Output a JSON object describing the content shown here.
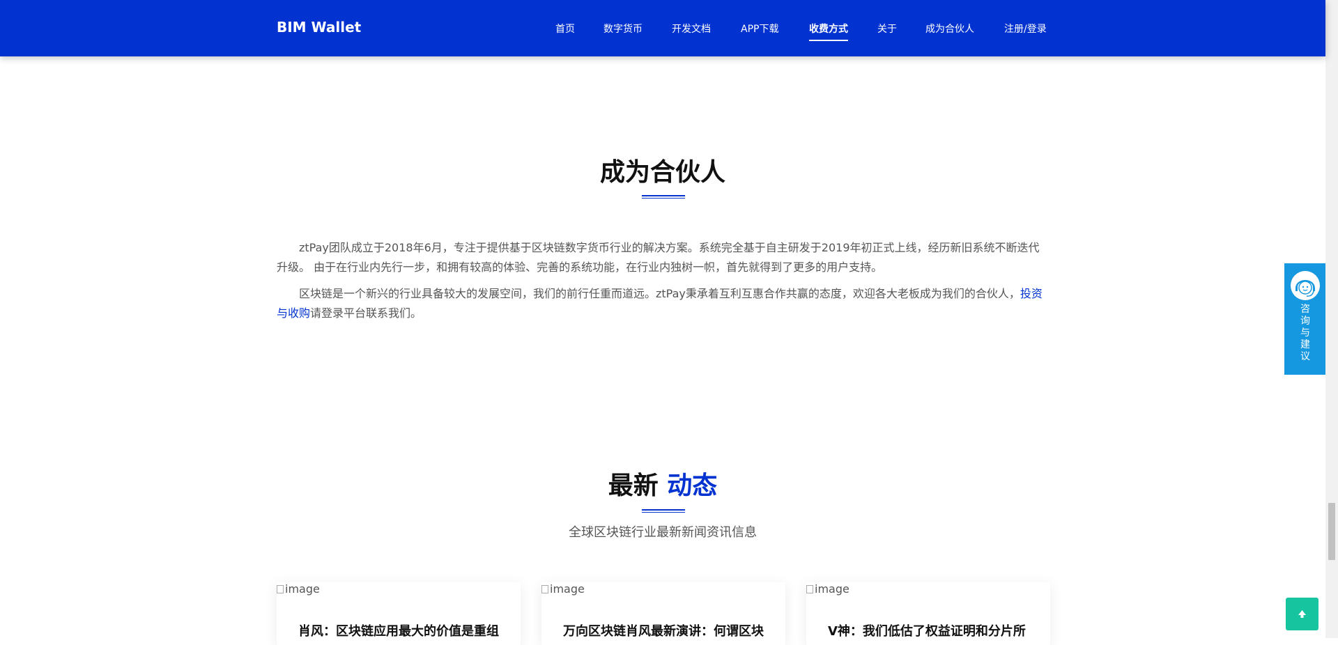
{
  "nav": {
    "brand": "BIM Wallet",
    "items": [
      {
        "label": "首页"
      },
      {
        "label": "数字货币"
      },
      {
        "label": "开发文档"
      },
      {
        "label": "APP下载"
      },
      {
        "label": "收费方式",
        "active": true
      },
      {
        "label": "关于"
      },
      {
        "label": "成为合伙人"
      },
      {
        "label": "注册/登录"
      }
    ]
  },
  "partner": {
    "title": "成为合伙人",
    "para1": "ztPay团队成立于2018年6月，专注于提供基于区块链数字货币行业的解决方案。系统完全基于自主研发于2019年初正式上线，经历新旧系统不断迭代升级。 由于在行业内先行一步，和拥有较高的体验、完善的系统功能，在行业内独树一帜，首先就得到了更多的用户支持。",
    "para2_text": "区块链是一个新兴的行业具备较大的发展空间，我们的前行任重而道远。ztPay秉承着互利互惠合作共赢的态度，欢迎各大老板成为我们的合伙人，",
    "para2_link": "投资与收购",
    "para2_tail": "请登录平台联系我们。"
  },
  "news": {
    "title_main": "最新",
    "title_accent": "动态",
    "subtitle": "全球区块链行业最新新闻资讯信息",
    "cards": [
      {
        "image_alt": "image",
        "title": "肖风：区块链应用最大的价值是重组"
      },
      {
        "image_alt": "image",
        "title": "万向区块链肖风最新演讲：何谓区块"
      },
      {
        "image_alt": "image",
        "title": "V神：我们低估了权益证明和分片所"
      }
    ]
  },
  "consult": {
    "label": "咨询与建议",
    "chars": [
      "咨",
      "询",
      "与",
      "建",
      "议"
    ]
  },
  "colors": {
    "brand": "#0233d0",
    "consult": "#1598e0",
    "back_top": "#16c5a0"
  },
  "icons": {
    "consult_avatar": "customer-service-icon",
    "back_top": "arrow-up-icon"
  }
}
